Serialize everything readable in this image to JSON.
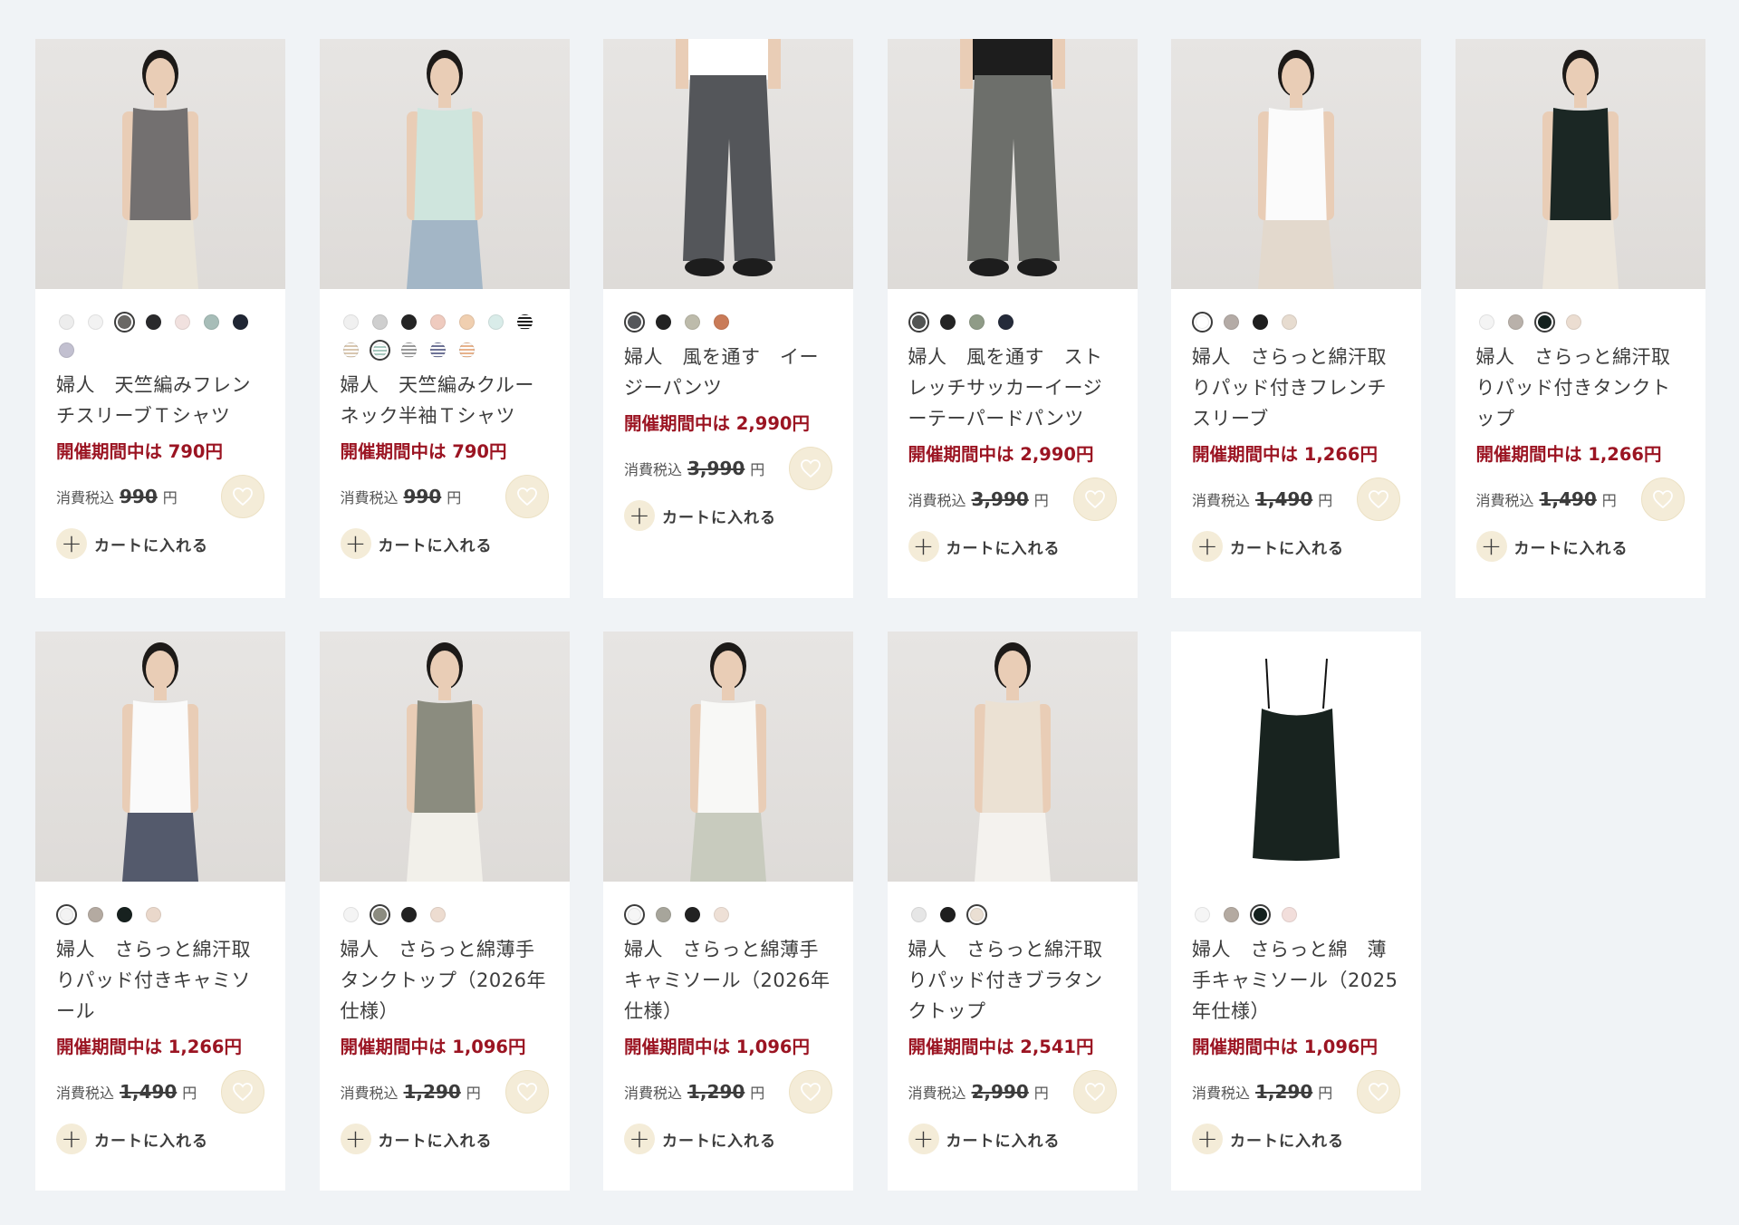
{
  "ui": {
    "tax_label": "消費税込",
    "yen": "円",
    "cart_label": "カートに入れる",
    "plus": "+"
  },
  "colors": {
    "sale_red": "#9b1422",
    "fav_bg": "#f4ecd8",
    "page_bg": "#f0f3f6"
  },
  "products": [
    {
      "name": "婦人　天竺編みフレンチスリーブＴシャツ",
      "sale": "開催期間中は 790円",
      "orig": "990",
      "swatches": [
        {
          "color": "#ededed"
        },
        {
          "color": "#f2f2f2"
        },
        {
          "color": "#6a6865",
          "selected": true
        },
        {
          "color": "#2a2a2c"
        },
        {
          "color": "#f1e1df"
        },
        {
          "color": "#a7bdb8"
        },
        {
          "color": "#202634"
        },
        {
          "color": "#c2c0d0"
        }
      ],
      "image": {
        "top": "#737070",
        "bottom": "#e9e4d8",
        "bg": "#e6e4e1"
      }
    },
    {
      "name": "婦人　天竺編みクルーネック半袖Ｔシャツ",
      "sale": "開催期間中は 790円",
      "orig": "990",
      "swatches": [
        {
          "color": "#f0f0f0"
        },
        {
          "color": "#cfcfcf"
        },
        {
          "color": "#252525"
        },
        {
          "color": "#efcbbf"
        },
        {
          "color": "#f0cfb0"
        },
        {
          "color": "#d9ece9"
        },
        {
          "color": "stripe-black"
        },
        {
          "color": "stripe-beige"
        },
        {
          "color": "stripe-mint",
          "selected": true
        },
        {
          "color": "stripe-grey"
        },
        {
          "color": "stripe-navy"
        },
        {
          "color": "stripe-orange"
        }
      ],
      "image": {
        "top": "#cfe5dd",
        "bottom": "#a3b6c6",
        "bg": "#e6e4e1"
      }
    },
    {
      "name": "婦人　風を通す　イージーパンツ",
      "sale": "開催期間中は 2,990円",
      "orig": "3,990",
      "swatches": [
        {
          "color": "#55575b",
          "selected": true
        },
        {
          "color": "#232323"
        },
        {
          "color": "#bdbbab"
        },
        {
          "color": "#c97b58"
        }
      ],
      "image": {
        "top": "#ffffff",
        "bottom": "#54565a",
        "bg": "#e6e4e1"
      }
    },
    {
      "name": "婦人　風を通す　ストレッチサッカーイージーテーパードパンツ",
      "sale": "開催期間中は 2,990円",
      "orig": "3,990",
      "swatches": [
        {
          "color": "#535554",
          "selected": true
        },
        {
          "color": "#242424"
        },
        {
          "color": "#8f9b87"
        },
        {
          "color": "#252b3a"
        }
      ],
      "image": {
        "top": "#1d1d1d",
        "bottom": "#6d6f6b",
        "bg": "#e6e4e1"
      }
    },
    {
      "name": "婦人　さらっと綿汗取りパッド付きフレンチスリーブ",
      "sale": "開催期間中は 1,266円",
      "orig": "1,490",
      "swatches": [
        {
          "color": "#ffffff",
          "selected": true
        },
        {
          "color": "#b4aba6"
        },
        {
          "color": "#1f1f1f"
        },
        {
          "color": "#e7dcd0"
        }
      ],
      "image": {
        "top": "#fbfbfb",
        "bottom": "#e3d9cd",
        "bg": "#e6e4e1"
      }
    },
    {
      "name": "婦人　さらっと綿汗取りパッド付きタンクトップ",
      "sale": "開催期間中は 1,266円",
      "orig": "1,490",
      "swatches": [
        {
          "color": "#f4f4f4"
        },
        {
          "color": "#b9b1aa"
        },
        {
          "color": "#14211e",
          "selected": true
        },
        {
          "color": "#ebddd1"
        }
      ],
      "image": {
        "top": "#1b2724",
        "bottom": "#ece6dc",
        "bg": "#e6e4e1"
      }
    },
    {
      "name": "婦人　さらっと綿汗取りパッド付きキャミソール",
      "sale": "開催期間中は 1,266円",
      "orig": "1,490",
      "swatches": [
        {
          "color": "#f3f3f3",
          "selected": true
        },
        {
          "color": "#b4aaa1"
        },
        {
          "color": "#17211f"
        },
        {
          "color": "#ead8cb"
        }
      ],
      "image": {
        "top": "#fafafa",
        "bottom": "#545a6c",
        "bg": "#e6e4e1"
      }
    },
    {
      "name": "婦人　さらっと綿薄手タンクトップ（2026年仕様）",
      "sale": "開催期間中は 1,096円",
      "orig": "1,290",
      "swatches": [
        {
          "color": "#f4f4f4"
        },
        {
          "color": "#8c8c80",
          "selected": true
        },
        {
          "color": "#222222"
        },
        {
          "color": "#eddcd0"
        }
      ],
      "image": {
        "top": "#8b8c7f",
        "bottom": "#f2f0ea",
        "bg": "#e6e4e1"
      }
    },
    {
      "name": "婦人　さらっと綿薄手キャミソール（2026年仕様）",
      "sale": "開催期間中は 1,096円",
      "orig": "1,290",
      "swatches": [
        {
          "color": "#f6f6f6",
          "selected": true
        },
        {
          "color": "#a7a59b"
        },
        {
          "color": "#222222"
        },
        {
          "color": "#eee0d6"
        }
      ],
      "image": {
        "top": "#f8f8f6",
        "bottom": "#c8cbbe",
        "bg": "#e6e4e1"
      }
    },
    {
      "name": "婦人　さらっと綿汗取りパッド付きブラタンクトップ",
      "sale": "開催期間中は 2,541円",
      "orig": "2,990",
      "swatches": [
        {
          "color": "#e6e6e6"
        },
        {
          "color": "#1f1f1f"
        },
        {
          "color": "#eadfd3",
          "selected": true
        }
      ],
      "image": {
        "top": "#ebe1d3",
        "bottom": "#f4f2ee",
        "bg": "#e6e4e1"
      }
    },
    {
      "name": "婦人　さらっと綿　薄手キャミソール（2025年仕様）",
      "sale": "開催期間中は 1,096円",
      "orig": "1,290",
      "swatches": [
        {
          "color": "#f5f5f5"
        },
        {
          "color": "#b4aaa1"
        },
        {
          "color": "#14211e",
          "selected": true
        },
        {
          "color": "#f2dedb"
        }
      ],
      "image": {
        "top": "#18231f",
        "bottom": "#ffffff",
        "bg": "#ffffff",
        "flat": true
      }
    }
  ]
}
